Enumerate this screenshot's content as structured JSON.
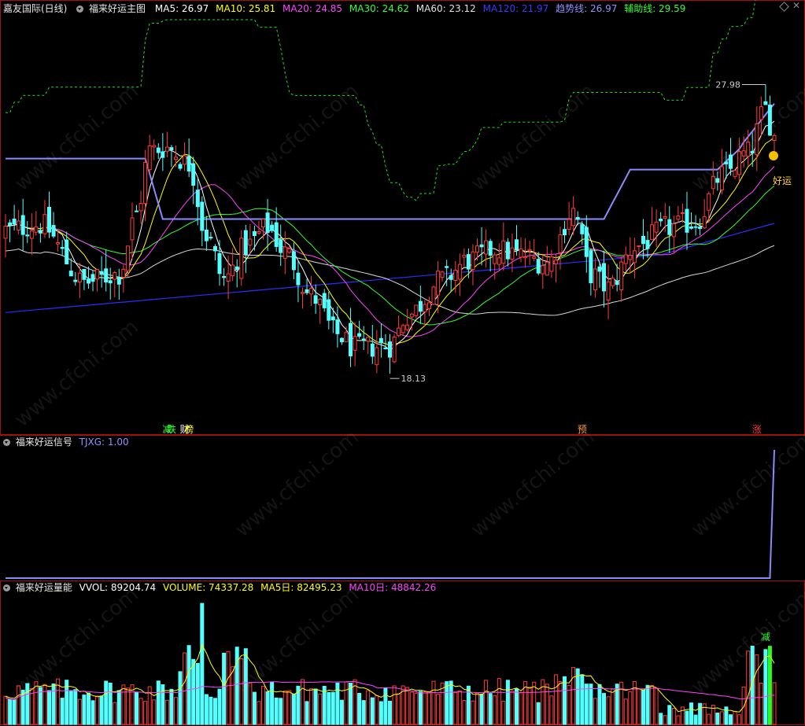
{
  "main_header": {
    "stock": "嘉友国际(日线)",
    "indicator": "福来好运主图",
    "items": [
      {
        "label": "MA5: 26.97",
        "color": "#ffffff"
      },
      {
        "label": "MA10: 25.81",
        "color": "#ffff00"
      },
      {
        "label": "MA20: 24.85",
        "color": "#ff44ff"
      },
      {
        "label": "MA30: 24.62",
        "color": "#33ff33"
      },
      {
        "label": "MA60: 23.12",
        "color": "#e0e0e0"
      },
      {
        "label": "MA120: 21.97",
        "color": "#3a3aff"
      },
      {
        "label": "趋势线: 26.97",
        "color": "#9090ff"
      },
      {
        "label": "辅助线: 29.59",
        "color": "#33ff33"
      }
    ]
  },
  "signal_header": {
    "indicator": "福来好运信号",
    "items": [
      {
        "label": "TJXG: 1.00",
        "color": "#9090ff"
      }
    ]
  },
  "volume_header": {
    "indicator": "福来好运量能",
    "items": [
      {
        "label": "VVOL: 89204.74",
        "color": "#ffffff"
      },
      {
        "label": "VOLUME: 74337.28",
        "color": "#ffff00"
      },
      {
        "label": "MA5日: 82495.23",
        "color": "#ffff00"
      },
      {
        "label": "MA10日: 48842.26",
        "color": "#ff44ff"
      }
    ]
  },
  "watermark": "www.cfchi.com",
  "colors": {
    "up": "#ff3b3b",
    "down": "#54ffff",
    "border": "#a01010",
    "ma5": "#ffffff",
    "ma10": "#ffff00",
    "ma20": "#ff44ff",
    "ma30": "#33ff33",
    "ma60": "#d8d8d8",
    "ma120": "#2d2dff",
    "trend": "#8a8aff",
    "aux": "#22dd22"
  },
  "chart_data": {
    "type": "candlestick",
    "price_ylim": [
      16.4,
      31.0
    ],
    "high_label": "27.98",
    "low_label": "18.13",
    "bottom_labels": [
      {
        "text": "减",
        "index": 37,
        "color": "#33ff33"
      },
      {
        "text": "跌",
        "index": 38,
        "color": "#33ff33"
      },
      {
        "text": "财",
        "index": 41,
        "color": "#ffffff"
      },
      {
        "text": "榜",
        "index": 42,
        "color": "#ffff00"
      },
      {
        "text": "预",
        "index": 132,
        "color": "#ff9a3a"
      },
      {
        "text": "涨",
        "index": 172,
        "color": "#ff3b3b"
      }
    ],
    "goodluck_label": "好运",
    "volume_label": "减",
    "tjxg_values_note": "0 for all bars except the final bar which is 1",
    "tjxg_last": 1.0
  }
}
